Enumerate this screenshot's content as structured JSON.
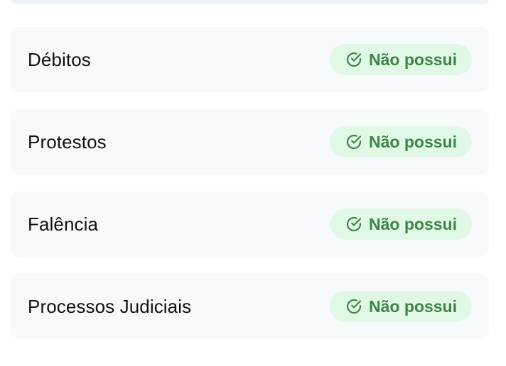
{
  "items": [
    {
      "label": "Débitos",
      "status": "Não possui",
      "status_icon": "check-circle-icon"
    },
    {
      "label": "Protestos",
      "status": "Não possui",
      "status_icon": "check-circle-icon"
    },
    {
      "label": "Falência",
      "status": "Não possui",
      "status_icon": "check-circle-icon"
    },
    {
      "label": "Processos Judiciais",
      "status": "Não possui",
      "status_icon": "check-circle-icon"
    }
  ],
  "colors": {
    "row_background": "#f8f9fb",
    "badge_background": "#e2f8e6",
    "badge_text": "#3e8546",
    "label_text": "#111111"
  }
}
